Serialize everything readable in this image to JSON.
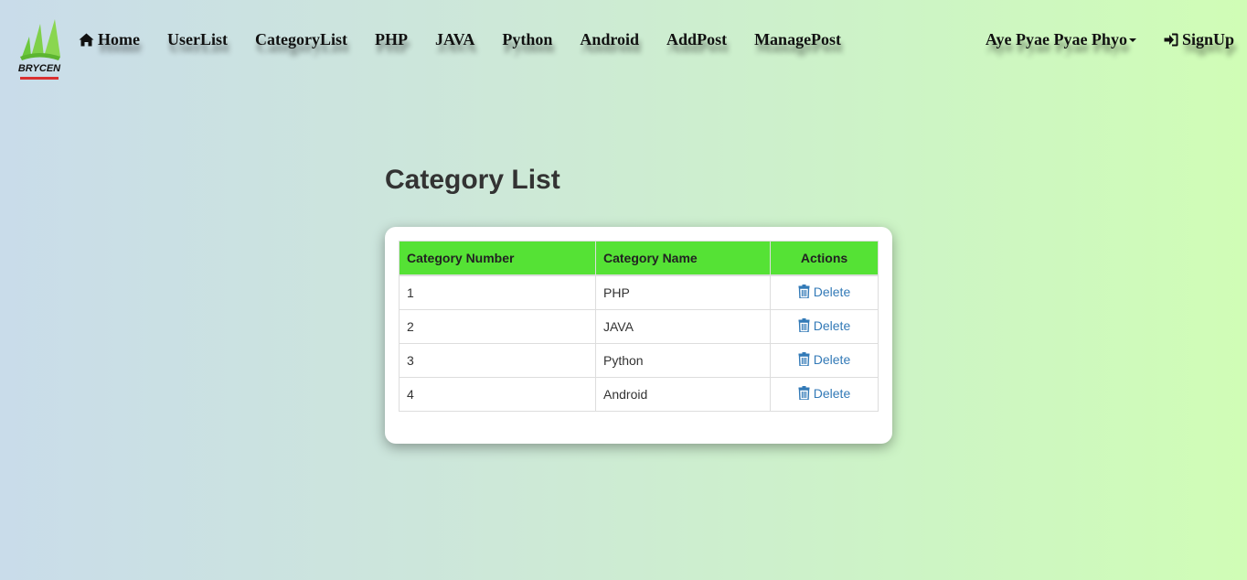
{
  "brand": {
    "logo_text": "BRYCEN"
  },
  "nav": {
    "home": "Home",
    "items": [
      "UserList",
      "CategoryList",
      "PHP",
      "JAVA",
      "Python",
      "Android",
      "AddPost",
      "ManagePost"
    ],
    "user": "Aye Pyae Pyae Phyo",
    "signup": "SignUp"
  },
  "page": {
    "title": "Category List"
  },
  "table": {
    "headers": [
      "Category Number",
      "Category Name",
      "Actions"
    ],
    "rows": [
      {
        "number": "1",
        "name": "PHP",
        "action": "Delete"
      },
      {
        "number": "2",
        "name": "JAVA",
        "action": "Delete"
      },
      {
        "number": "3",
        "name": "Python",
        "action": "Delete"
      },
      {
        "number": "4",
        "name": "Android",
        "action": "Delete"
      }
    ]
  },
  "colors": {
    "header_green": "#55e235",
    "link_blue": "#337ab7"
  },
  "icons": {
    "home": "home-icon",
    "signup": "sign-in-icon",
    "delete": "trash-icon",
    "user_dropdown": "caret-down-icon"
  }
}
